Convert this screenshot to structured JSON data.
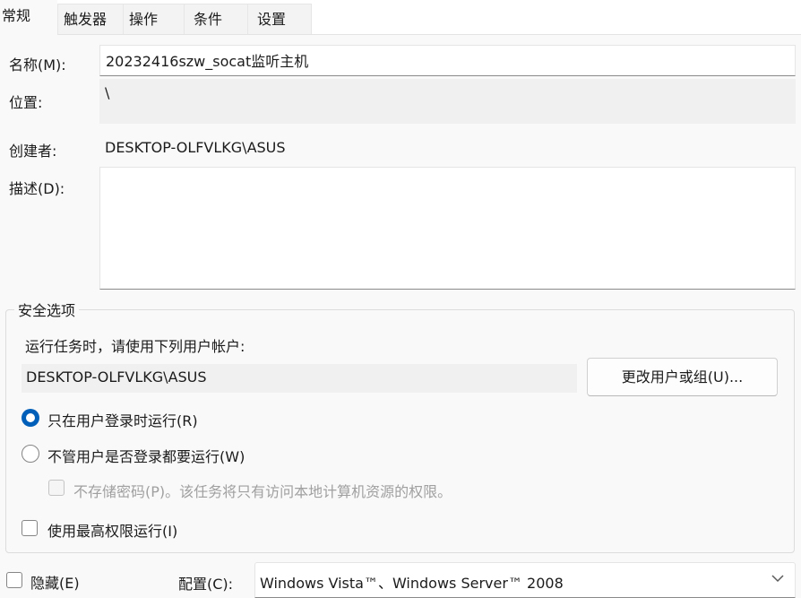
{
  "tabs": [
    {
      "label": "常规",
      "active": true
    },
    {
      "label": "触发器",
      "active": false
    },
    {
      "label": "操作",
      "active": false
    },
    {
      "label": "条件",
      "active": false
    },
    {
      "label": "设置",
      "active": false
    }
  ],
  "general": {
    "name_label": "名称(M):",
    "name_value": "20232416szw_socat监听主机",
    "location_label": "位置:",
    "location_value": "\\",
    "author_label": "创建者:",
    "author_value": "DESKTOP-OLFVLKG\\ASUS",
    "description_label": "描述(D):",
    "description_value": ""
  },
  "security": {
    "group_title": "安全选项",
    "run_as_prompt": "运行任务时，请使用下列用户帐户:",
    "account": "DESKTOP-OLFVLKG\\ASUS",
    "change_user_button": "更改用户或组(U)...",
    "radio_logged_on": "只在用户登录时运行(R)",
    "radio_whether_logged": "不管用户是否登录都要运行(W)",
    "no_store_password": "不存储密码(P)。该任务将只有访问本地计算机资源的权限。",
    "highest_privileges": "使用最高权限运行(I)"
  },
  "footer": {
    "hidden_label": "隐藏(E)",
    "configure_label": "配置(C):",
    "configure_value": "Windows Vista™、Windows Server™ 2008"
  },
  "colors": {
    "accent": "#005fb8"
  },
  "icons": {
    "dropdown": "chevron-down-icon"
  }
}
